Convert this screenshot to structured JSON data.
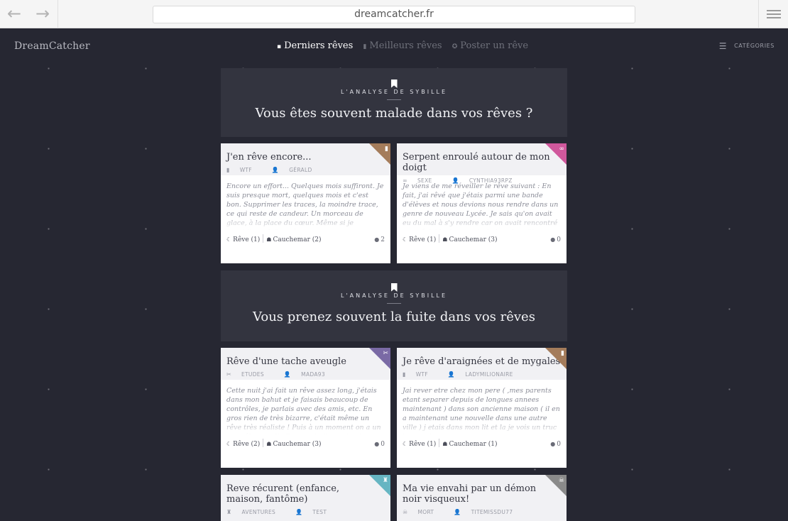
{
  "browser": {
    "url": "dreamcatcher.fr",
    "back_icon": "←",
    "forward_icon": "→"
  },
  "site": {
    "logo": "DreamCatcher",
    "tabs": [
      {
        "label": "Derniers rêves",
        "icon": "▪"
      },
      {
        "label": "Meilleurs rêves",
        "icon": "▮"
      },
      {
        "label": "Poster un rêve",
        "icon": "✪"
      }
    ],
    "categories_label": "CATÉGORIES"
  },
  "analyses": [
    {
      "kicker": "L'ANALYSE DE SYBILLE",
      "title": "Vous êtes souvent malade dans vos rêves ?"
    },
    {
      "kicker": "L'ANALYSE DE SYBILLE",
      "title": "Vous prenez souvent la fuite dans vos rêves"
    }
  ],
  "cards": [
    {
      "title": "J'en rêve encore...",
      "category": "WTF",
      "author": "GÉRALD",
      "corner_color": "#a47c5b",
      "corner_icon": "▮",
      "excerpt": "Encore un effort... Quelques mois suffiront. Je suis presque mort, quelques mois et c'est bon. Supprimer les traces, la moindre trace, ce qui reste de candeur. Un morceau de glace, à la place du cœur. Même si je m'en'dige, oh j'en rêve encore.",
      "reve": "Rêve (1)",
      "cauchemar": "Cauchemar (2)",
      "comments": "2"
    },
    {
      "title": "Serpent enroulé autour de mon doigt",
      "category": "SEXE",
      "author": "CYNTHIA93RPZ",
      "corner_color": "#d0589c",
      "corner_icon": "∞",
      "excerpt": "Je viens de me réveiller le rêve suivant : En fait, j'ai rêvé que j'étais parmi une bande d'élèves et nous devions nous rendre dans un genre de nouveau Lycée. Je sais qu'on avait eu du mal à s'y rendre car on avait rencontré au préalable des soucis de bus dans l'heure.",
      "reve": "Rêve (1)",
      "cauchemar": "Cauchemar (3)",
      "comments": "0"
    },
    {
      "title": "Rêve d'une tache aveugle",
      "category": "ETUDES",
      "author": "MADA93",
      "corner_color": "#7a6aa5",
      "corner_icon": "✂",
      "excerpt": "Cette nuit j'ai fait un rêve assez long, j'étais dans mon bahut et je faisais beaucoup de contrôles, je parlais avec des amis, etc. En gros rien de très bizarre, c'était même un rêve très réaliste ! Puis à un moment on a un contrôle en salle 7, il s'agit d'un sujet de géographie.",
      "reve": "Rêve (2)",
      "cauchemar": "Cauchemar (3)",
      "comments": "0"
    },
    {
      "title": "Je rêve d'araignées et de mygales",
      "category": "WTF",
      "author": "LADYMILIONAIRE",
      "corner_color": "#a47c5b",
      "corner_icon": "▮",
      "excerpt": "Jai rever etre chez mon pere ( ,mes parents etant separer depuis de longues annees maintenant ) dans son ancienne maison ( il en a maintenant une nouvelle dans une autre ville ) j etais dans mon lit et la je vois un truc bouger j ouvre un peu plus la couverture.",
      "reve": "Rêve (1)",
      "cauchemar": "Cauchemar (1)",
      "comments": "0"
    },
    {
      "title": "Reve récurent (enfance, maison, fantôme)",
      "category": "AVENTURES",
      "author": "TEST",
      "corner_color": "#66b5c2",
      "corner_icon": "♜"
    },
    {
      "title": "Ma vie envahi par un démon noir visqueux!",
      "category": "MORT",
      "author": "TITEMISSDU77",
      "corner_color": "#8a8a8a",
      "corner_icon": "☠"
    }
  ]
}
